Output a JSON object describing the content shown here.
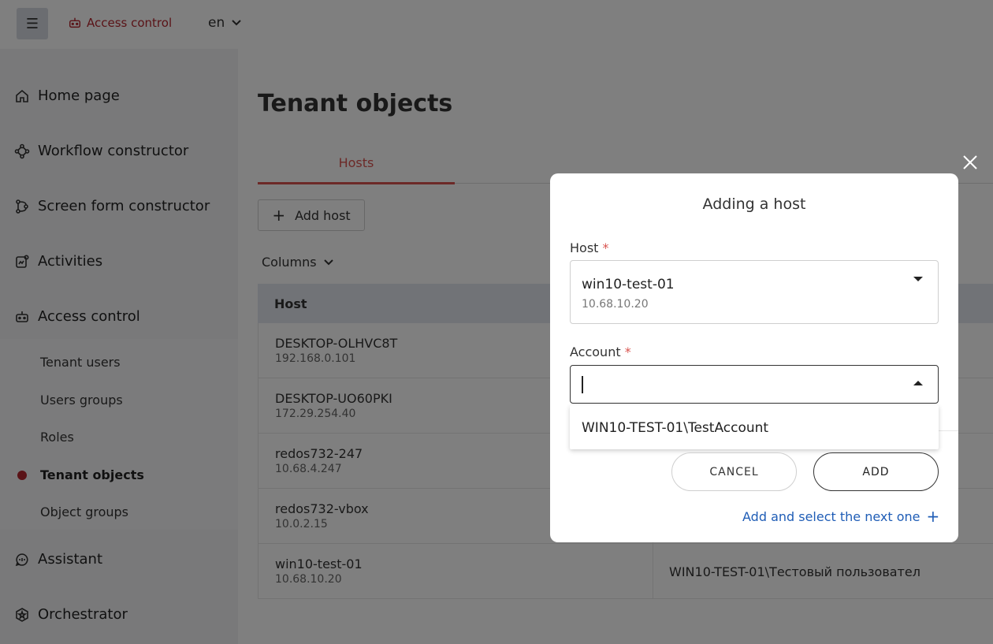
{
  "topbar": {
    "brand": "Access control",
    "language": "en"
  },
  "sidebar": {
    "items": [
      {
        "label": "Home page"
      },
      {
        "label": "Workflow constructor"
      },
      {
        "label": "Screen form constructor"
      },
      {
        "label": "Activities"
      },
      {
        "label": "Access control"
      },
      {
        "label": "Assistant"
      },
      {
        "label": "Orchestrator"
      }
    ],
    "sub_items": [
      {
        "label": "Tenant users"
      },
      {
        "label": "Users groups"
      },
      {
        "label": "Roles"
      },
      {
        "label": "Tenant objects"
      },
      {
        "label": "Object groups"
      }
    ]
  },
  "main": {
    "title": "Tenant objects",
    "tab": "Hosts",
    "add_host": "Add host",
    "columns": "Columns",
    "table_header": "Host",
    "rows": [
      {
        "name": "DESKTOP-OLHVC8T",
        "ip": "192.168.0.101",
        "account": ""
      },
      {
        "name": "DESKTOP-UO60PKI",
        "ip": "172.29.254.40",
        "account": ""
      },
      {
        "name": "redos732-247",
        "ip": "10.68.4.247",
        "account": ""
      },
      {
        "name": "redos732-vbox",
        "ip": "10.0.2.15",
        "account": ""
      },
      {
        "name": "win10-test-01",
        "ip": "10.68.10.20",
        "account": "WIN10-TEST-01\\Тестовый пользовател"
      }
    ]
  },
  "modal": {
    "title": "Adding a host",
    "host_label": "Host",
    "required_mark": "*",
    "host_value": "win10-test-01",
    "host_ip": "10.68.10.20",
    "account_label": "Account",
    "account_value": "",
    "dropdown_option": "WIN10-TEST-01\\TestAccount",
    "cancel": "CANCEL",
    "add": "ADD",
    "next_link": "Add and select the next one",
    "next_plus": "+"
  },
  "colors": {
    "accent": "#b5262e",
    "tab_active": "#d9534f",
    "link": "#1f5db6"
  }
}
